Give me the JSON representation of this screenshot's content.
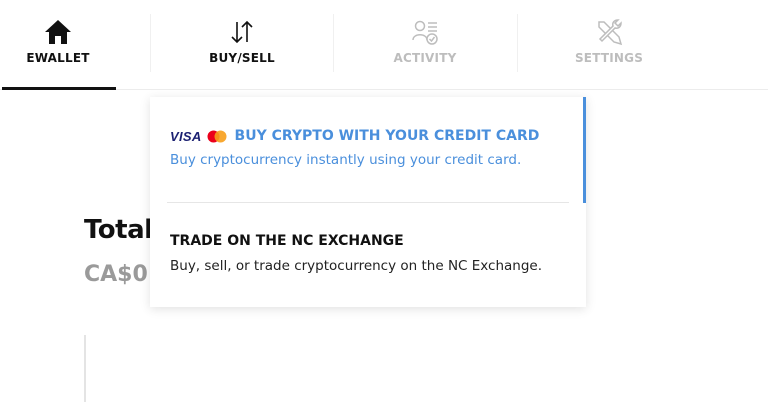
{
  "nav": {
    "tabs": [
      {
        "label": "EWALLET",
        "icon": "home-icon",
        "active": true
      },
      {
        "label": "BUY/SELL",
        "icon": "buy-sell-arrows-icon",
        "active": false
      },
      {
        "label": "ACTIVITY",
        "icon": "activity-user-list-icon",
        "active": false
      },
      {
        "label": "SETTINGS",
        "icon": "wrench-screwdriver-icon",
        "active": false
      }
    ]
  },
  "main": {
    "total_label": "Total",
    "total_amount": "CA$0"
  },
  "dropdown": {
    "items": [
      {
        "logo_text": "VISA",
        "title": "BUY CRYPTO WITH YOUR CREDIT CARD",
        "description": "Buy cryptocurrency instantly using your credit card."
      },
      {
        "title": "TRADE ON THE NC EXCHANGE",
        "description": "Buy, sell, or trade cryptocurrency on the NC Exchange."
      }
    ]
  },
  "colors": {
    "accent_blue": "#4a8fdc",
    "text_dark": "#111111",
    "text_muted": "#9a9a9a",
    "visa_navy": "#1a1f71",
    "mastercard_red": "#eb001b",
    "mastercard_orange": "#f79e1b"
  }
}
